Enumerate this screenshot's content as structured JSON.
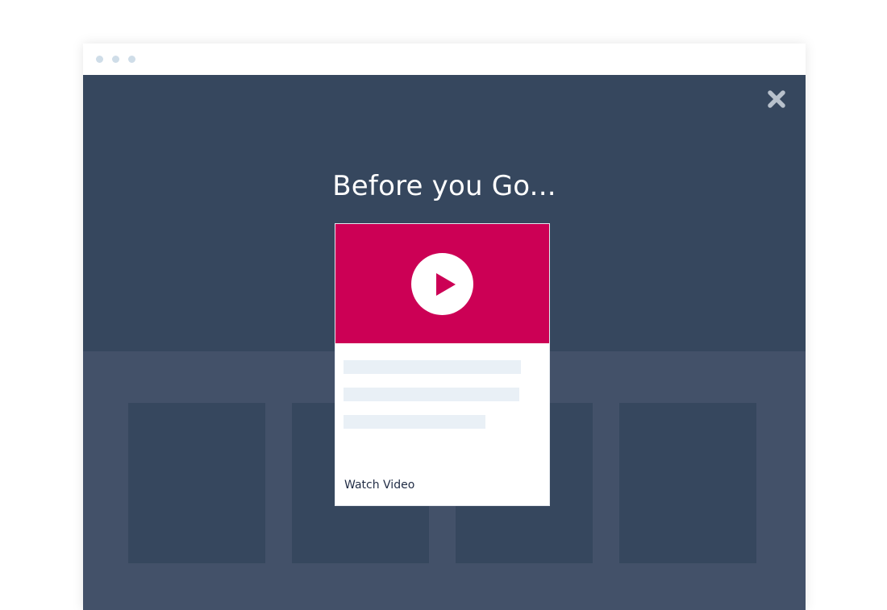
{
  "colors": {
    "page_background": "#ffffff",
    "window_dot": "#cfdde8",
    "hero_background": "#36475e",
    "lower_background": "#435169",
    "grid_card": "#36475e",
    "close_icon": "#b8c1cc",
    "video_thumbnail": "#cc0055",
    "play_icon": "#cc0055",
    "text_placeholder": "#e9f0f6"
  },
  "popup": {
    "title": "Before you Go...",
    "close_icon": "close-icon",
    "video_card": {
      "thumbnail_icon": "play-icon",
      "link_label": "Watch Video"
    }
  }
}
